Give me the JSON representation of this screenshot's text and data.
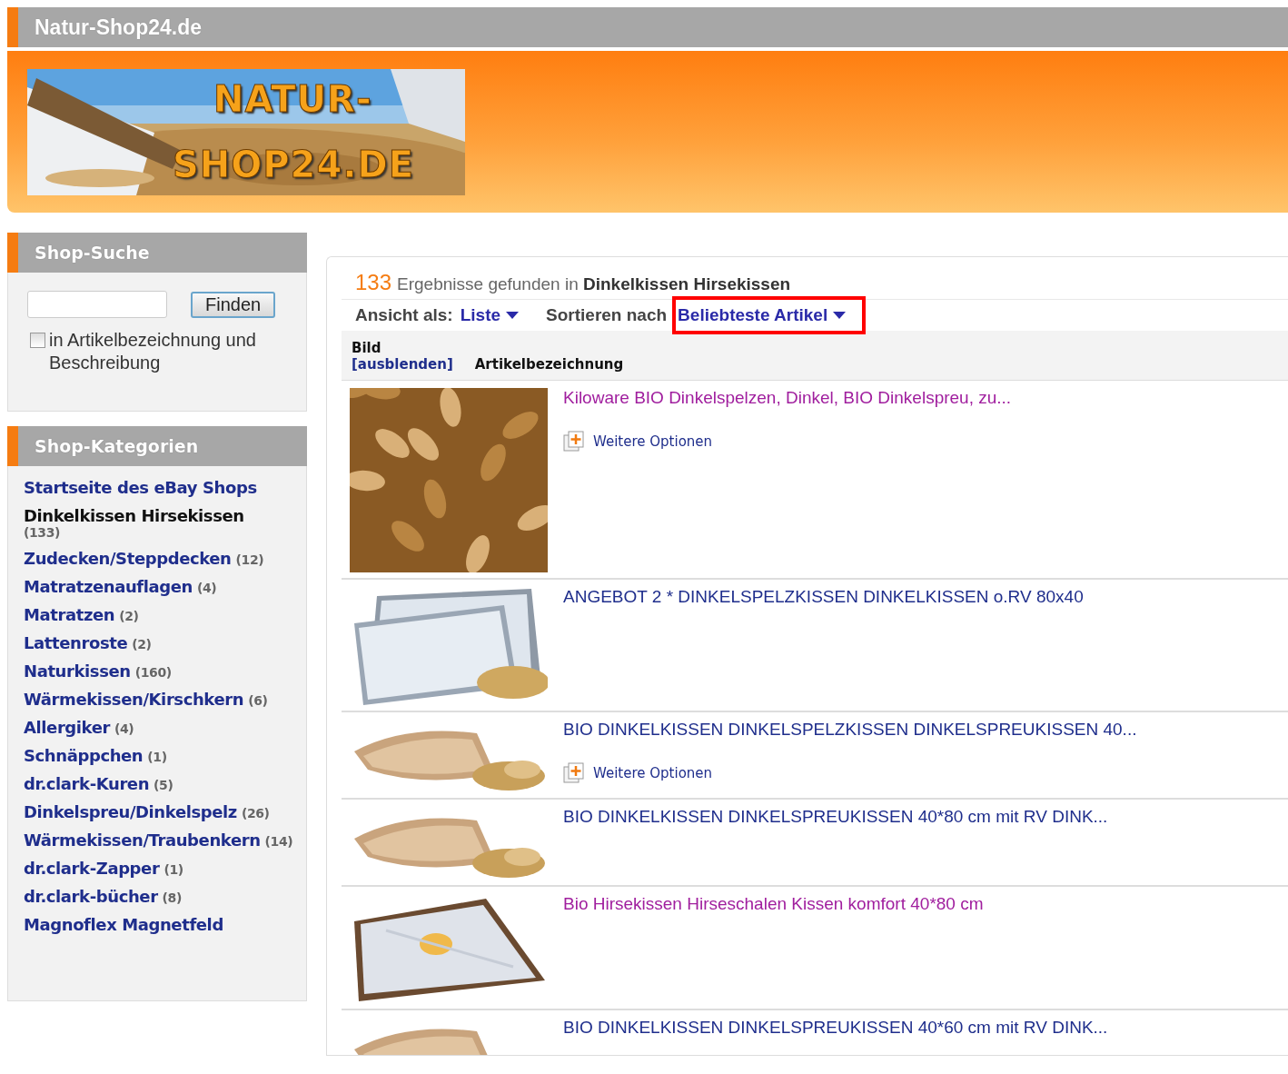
{
  "site_bar": {
    "title": "Natur-Shop24.de"
  },
  "banner": {
    "logo_lines": [
      "NATUR-",
      "SHOP24.DE"
    ]
  },
  "search_box": {
    "title": "Shop-Suche",
    "button": "Finden",
    "checkbox": {
      "label": "in Artikelbezeichnung und Beschreibung",
      "checked": false
    }
  },
  "categories": {
    "title": "Shop-Kategorien",
    "items": [
      {
        "label": "Startseite des eBay Shops",
        "selected": false
      },
      {
        "label": "Dinkelkissen Hirsekissen",
        "count": "(133)",
        "selected": true
      },
      {
        "label": "Zudecken/Steppdecken",
        "count": "(12)",
        "selected": false
      },
      {
        "label": "Matratzenauflagen",
        "count": "(4)",
        "selected": false
      },
      {
        "label": "Matratzen",
        "count": "(2)",
        "selected": false
      },
      {
        "label": "Lattenroste",
        "count": "(2)",
        "selected": false
      },
      {
        "label": "Naturkissen",
        "count": "(160)",
        "selected": false
      },
      {
        "label": "Wärmekissen/Kirschkern",
        "count": "(6)",
        "selected": false
      },
      {
        "label": "Allergiker",
        "count": "(4)",
        "selected": false
      },
      {
        "label": "Schnäppchen",
        "count": "(1)",
        "selected": false
      },
      {
        "label": "dr.clark-Kuren",
        "count": "(5)",
        "selected": false
      },
      {
        "label": "Dinkelspreu/Dinkelspelz",
        "count": "(26)",
        "selected": false
      },
      {
        "label": "Wärmekissen/Traubenkern",
        "count": "(14)",
        "selected": false
      },
      {
        "label": "dr.clark-Zapper",
        "count": "(1)",
        "selected": false
      },
      {
        "label": "dr.clark-bücher",
        "count": "(8)",
        "selected": false
      },
      {
        "label": "Magnoflex Magnetfeld",
        "selected": false
      }
    ]
  },
  "results": {
    "count": "133",
    "summary": "Ergebnisse gefunden in **Dinkelkissen Hirsekissen**",
    "view": {
      "label": "Ansicht als:",
      "value": "Liste"
    },
    "sort": {
      "label": "Sortieren nach",
      "value": "Beliebteste Artikel",
      "highlighted": true
    },
    "columns": [
      {
        "title": "Bild",
        "link": "[ausblenden]"
      },
      {
        "title": "Artikelbezeichnung"
      }
    ],
    "rows": [
      {
        "title": "Kiloware BIO Dinkelspelzen, Dinkel, BIO Dinkelspreu, zu...",
        "visited": true,
        "options_link": "Weitere Optionen"
      },
      {
        "title": "ANGEBOT 2 * DINKELSPELZKISSEN DINKELKISSEN o.RV 80x40",
        "visited": false
      },
      {
        "title": "BIO DINKELKISSEN DINKELSPELZKISSEN DINKELSPREUKISSEN 40...",
        "visited": false,
        "options_link": "Weitere Optionen"
      },
      {
        "title": "BIO DINKELKISSEN DINKELSPREUKISSEN 40*80 cm mit RV DINK...",
        "visited": false
      },
      {
        "title": "Bio Hirsekissen Hirseschalen Kissen komfort 40*80 cm",
        "visited": true
      },
      {
        "title": "BIO DINKELKISSEN DINKELSPREUKISSEN 40*60 cm mit RV DINK...",
        "visited": false
      }
    ]
  }
}
